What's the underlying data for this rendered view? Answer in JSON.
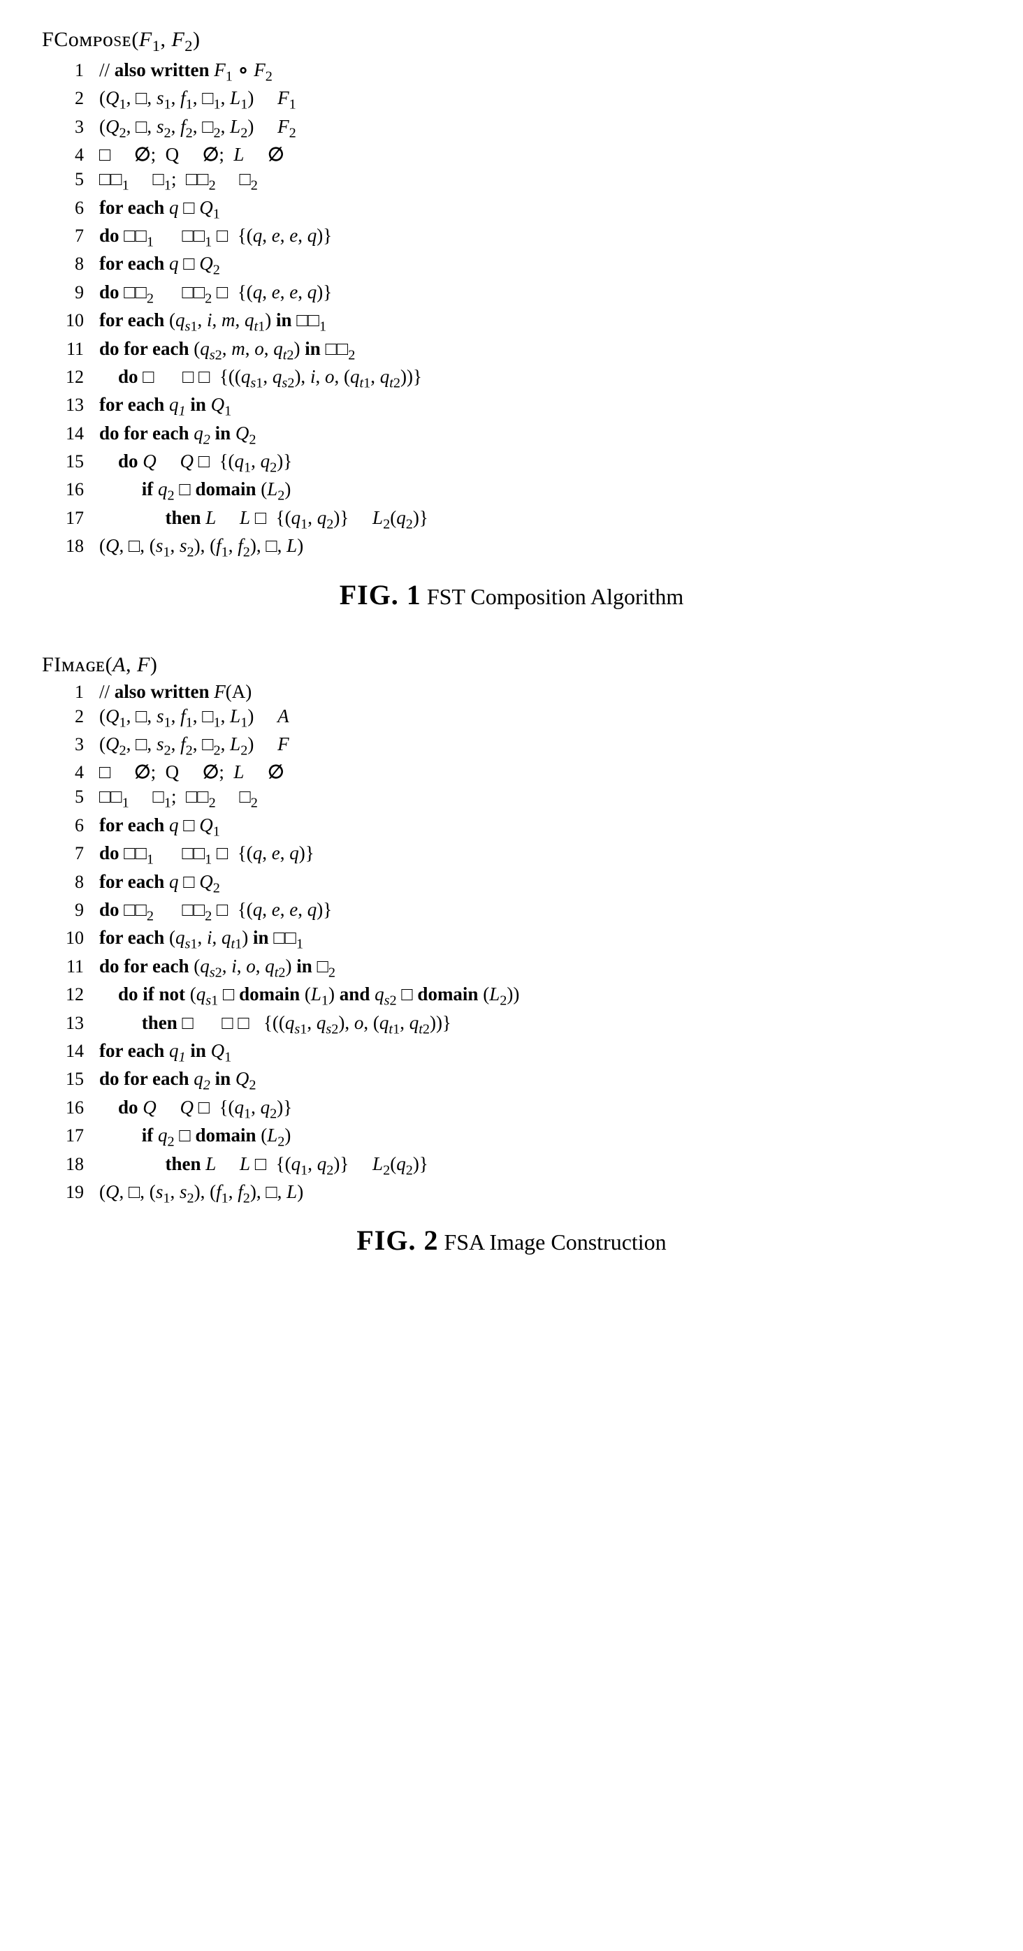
{
  "fig1": {
    "title": "FCᴏᴍᴘᴏsᴇ(F₁, F₂)",
    "lines": [
      "// also written F₁ ∘ F₂",
      "(Q₁, □, s₁, f₁, □₁, L₁)    F₁",
      "(Q₂, □, s₂, f₂, □₂, L₂)    F₂",
      "□    ∅;  Q    ∅;  L    ∅",
      "□□₁    □₁;  □□₂    □₂",
      "for each q □ Q₁",
      "do □□₁     □□₁ □  {(q, e, e, q)}",
      "for each q □ Q₂",
      "do □□₂     □□₂ □  {(q, e, e, q)}",
      "for each (qₛ₁, i, m, qₜ₁) in □□₁",
      "do for each (qₛ₂, m, o, qₜ₂) in □□₂",
      "   do □     □ □  {((qₛ₁, qₛ₂), i, o, (qₜ₁, qₜ₂))}",
      "for each q₁ in Q₁",
      "do for each q₂ in Q₂",
      "   do Q     Q □  {(q₁, q₂)}",
      "       if q₂ □ domain (L₂)",
      "           then L     L □  {(q₁, q₂)}    L₂(q₂)}",
      "(Q, □, (s₁, s₂), (f₁, f₂), □, L)"
    ],
    "caption_fig": "FIG. 1",
    "caption_text": "  FST Composition Algorithm"
  },
  "fig2": {
    "title": "FIᴍᴀɢᴇ(A, F)",
    "lines": [
      "// also written F(A)",
      "(Q₁, □, s₁, f₁, □₁, L₁)    A",
      "(Q₂, □, s₂, f₂, □₂, L₂)    F",
      "□    ∅;  Q    ∅;  L    ∅",
      "□□₁    □₁;  □□₂    □₂",
      "for each q □ Q₁",
      "do □□₁     □□₁ □  {(q, e, q)}",
      "for each q □ Q₂",
      "do □□₂     □□₂ □  {(q, e, e, q)}",
      "for each (qₛ₁, i, qₜ₁) in □□₁",
      "do for each (qₛ₂, i, o, qₜ₂) in □₂",
      "   do if not (qₛ₁ □ domain (L₁) and qₛ₂ □ domain (L₂))",
      "       then □     □ □  {((qₛ₁, qₛ₂), o, (qₜ₁, qₜ₂))}",
      "for each q₁ in Q₁",
      "do for each q₂ in Q₂",
      "   do Q     Q □  {(q₁, q₂)}",
      "       if q₂ □ domain (L₂)",
      "           then L     L □  {(q₁, q₂)}    L₂(q₂)}",
      "(Q, □, (s₁, s₂), (f₁, f₂), □, L)"
    ],
    "caption_fig": "FIG. 2",
    "caption_text": "  FSA Image Construction"
  }
}
